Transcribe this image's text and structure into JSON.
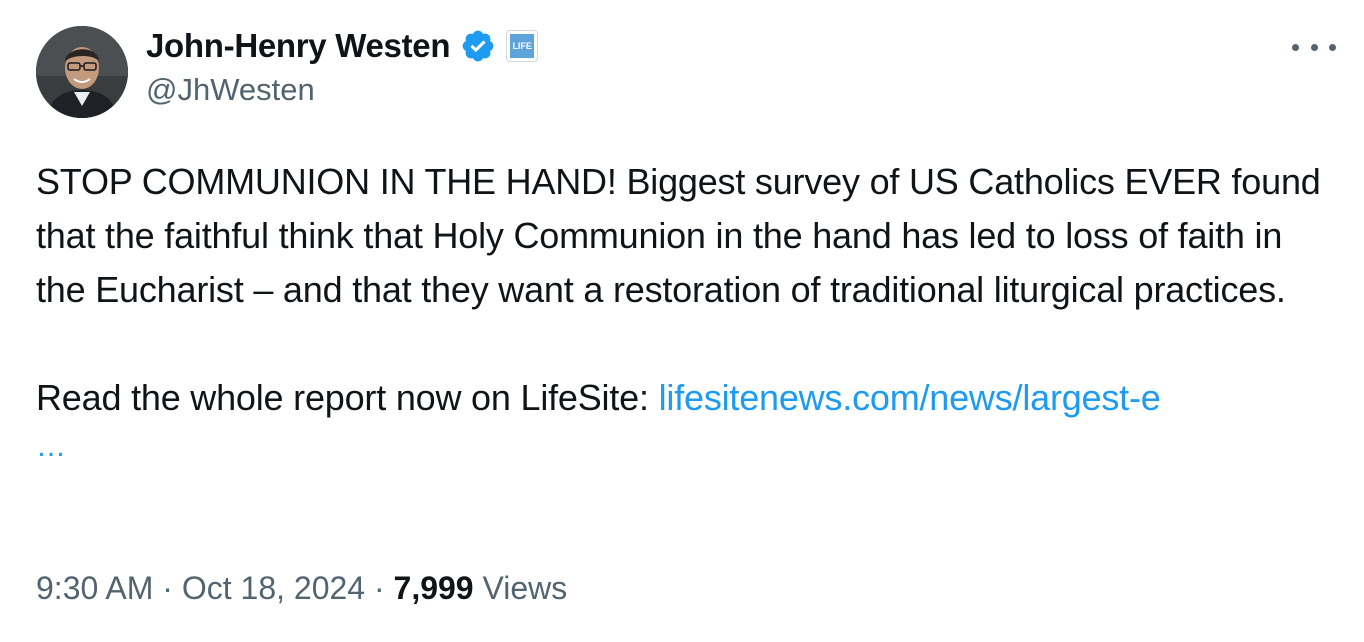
{
  "author": {
    "display_name": "John-Henry Westen",
    "handle": "@JhWesten",
    "affiliate_badge_text": "LIFE",
    "verified_color": "#1d9bf0"
  },
  "tweet": {
    "paragraph_1": "STOP COMMUNION IN THE HAND! Biggest survey of US Catholics EVER found that the faithful think that Holy Communion in the hand has led to loss of faith in the Eucharist – and that they want a restoration of traditional liturgical practices.",
    "paragraph_2_prefix": "Read the whole report now on LifeSite: ",
    "link_text": "lifesitenews.com/news/largest-e",
    "link_ellipsis": "…"
  },
  "meta": {
    "time": "9:30 AM",
    "separator": " · ",
    "date": "Oct 18, 2024",
    "views_count": "7,999",
    "views_label": " Views"
  },
  "icons": {
    "more": "more-options-icon",
    "verified": "verified-badge-icon"
  }
}
